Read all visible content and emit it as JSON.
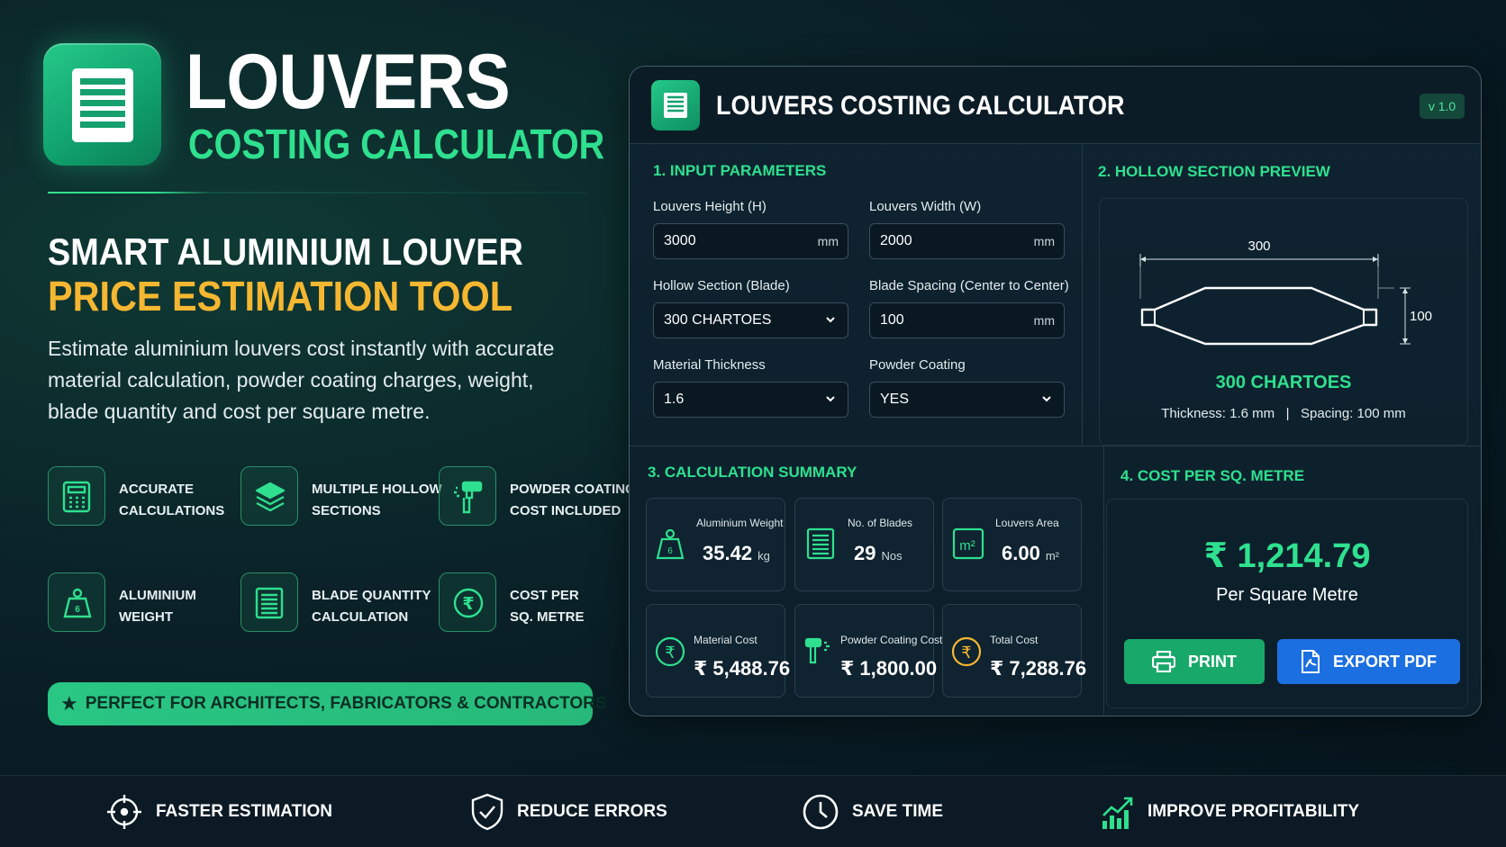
{
  "hero": {
    "title": "LOUVERS",
    "subtitle": "COSTING CALCULATOR",
    "tagline_1": "SMART ALUMINIUM LOUVER",
    "tagline_2": "PRICE ESTIMATION TOOL",
    "description": "Estimate aluminium louvers cost instantly with accurate material calculation, powder coating charges, weight, blade quantity and cost per square metre.",
    "features": [
      {
        "line1": "ACCURATE",
        "line2": "CALCULATIONS",
        "icon": "calculator-icon"
      },
      {
        "line1": "MULTIPLE HOLLOW",
        "line2": "SECTIONS",
        "icon": "layers-icon"
      },
      {
        "line1": "POWDER COATING",
        "line2": "COST INCLUDED",
        "icon": "spray-gun-icon"
      },
      {
        "line1": "ALUMINIUM",
        "line2": "WEIGHT",
        "icon": "weight-icon"
      },
      {
        "line1": "BLADE QUANTITY",
        "line2": "CALCULATION",
        "icon": "blades-icon"
      },
      {
        "line1": "COST PER",
        "line2": "SQ. METRE",
        "icon": "rupee-icon"
      }
    ],
    "banner": "PERFECT FOR ARCHITECTS, FABRICATORS & CONTRACTORS"
  },
  "app": {
    "title": "LOUVERS COSTING CALCULATOR",
    "version": "v 1.0",
    "inputs": {
      "section_title": "1. INPUT PARAMETERS",
      "height_label": "Louvers Height (H)",
      "height_value": "3000",
      "height_unit": "mm",
      "width_label": "Louvers Width (W)",
      "width_value": "2000",
      "width_unit": "mm",
      "section_label": "Hollow Section (Blade)",
      "section_value": "300 CHARTOES",
      "spacing_label": "Blade Spacing (Center to Center)",
      "spacing_value": "100",
      "spacing_unit": "mm",
      "thickness_label": "Material Thickness",
      "thickness_value": "1.6",
      "coating_label": "Powder Coating",
      "coating_value": "YES"
    },
    "preview": {
      "section_title": "2. HOLLOW SECTION PREVIEW",
      "dim_width": "300",
      "dim_height": "100",
      "name": "300 CHARTOES",
      "details": "Thickness: 1.6 mm   |   Spacing: 100 mm"
    },
    "summary": {
      "section_title": "3. CALCULATION SUMMARY",
      "weight_label": "Aluminium Weight",
      "weight_value": "35.42",
      "weight_unit": "kg",
      "blades_label": "No. of Blades",
      "blades_value": "29",
      "blades_unit": "Nos",
      "area_label": "Louvers Area",
      "area_value": "6.00",
      "area_unit": "m²",
      "material_label": "Material Cost",
      "material_value": "₹ 5,488.76",
      "coating_label": "Powder Coating Cost",
      "coating_value": "₹ 1,800.00",
      "total_label": "Total Cost",
      "total_value": "₹ 7,288.76"
    },
    "cost": {
      "section_title": "4. COST PER SQ. METRE",
      "value": "₹ 1,214.79",
      "caption": "Per Square Metre",
      "print_label": "PRINT",
      "export_label": "EXPORT PDF"
    }
  },
  "footer": {
    "items": [
      {
        "label": "FASTER ESTIMATION",
        "icon": "crosshair-icon"
      },
      {
        "label": "REDUCE ERRORS",
        "icon": "shield-check-icon"
      },
      {
        "label": "SAVE TIME",
        "icon": "clock-icon"
      },
      {
        "label": "IMPROVE PROFITABILITY",
        "icon": "growth-chart-icon"
      }
    ]
  },
  "colors": {
    "accent_green": "#2fe08f",
    "accent_gold": "#f5b731",
    "export_blue": "#1c6fe0",
    "print_green": "#18a86a",
    "background": "#071820"
  }
}
